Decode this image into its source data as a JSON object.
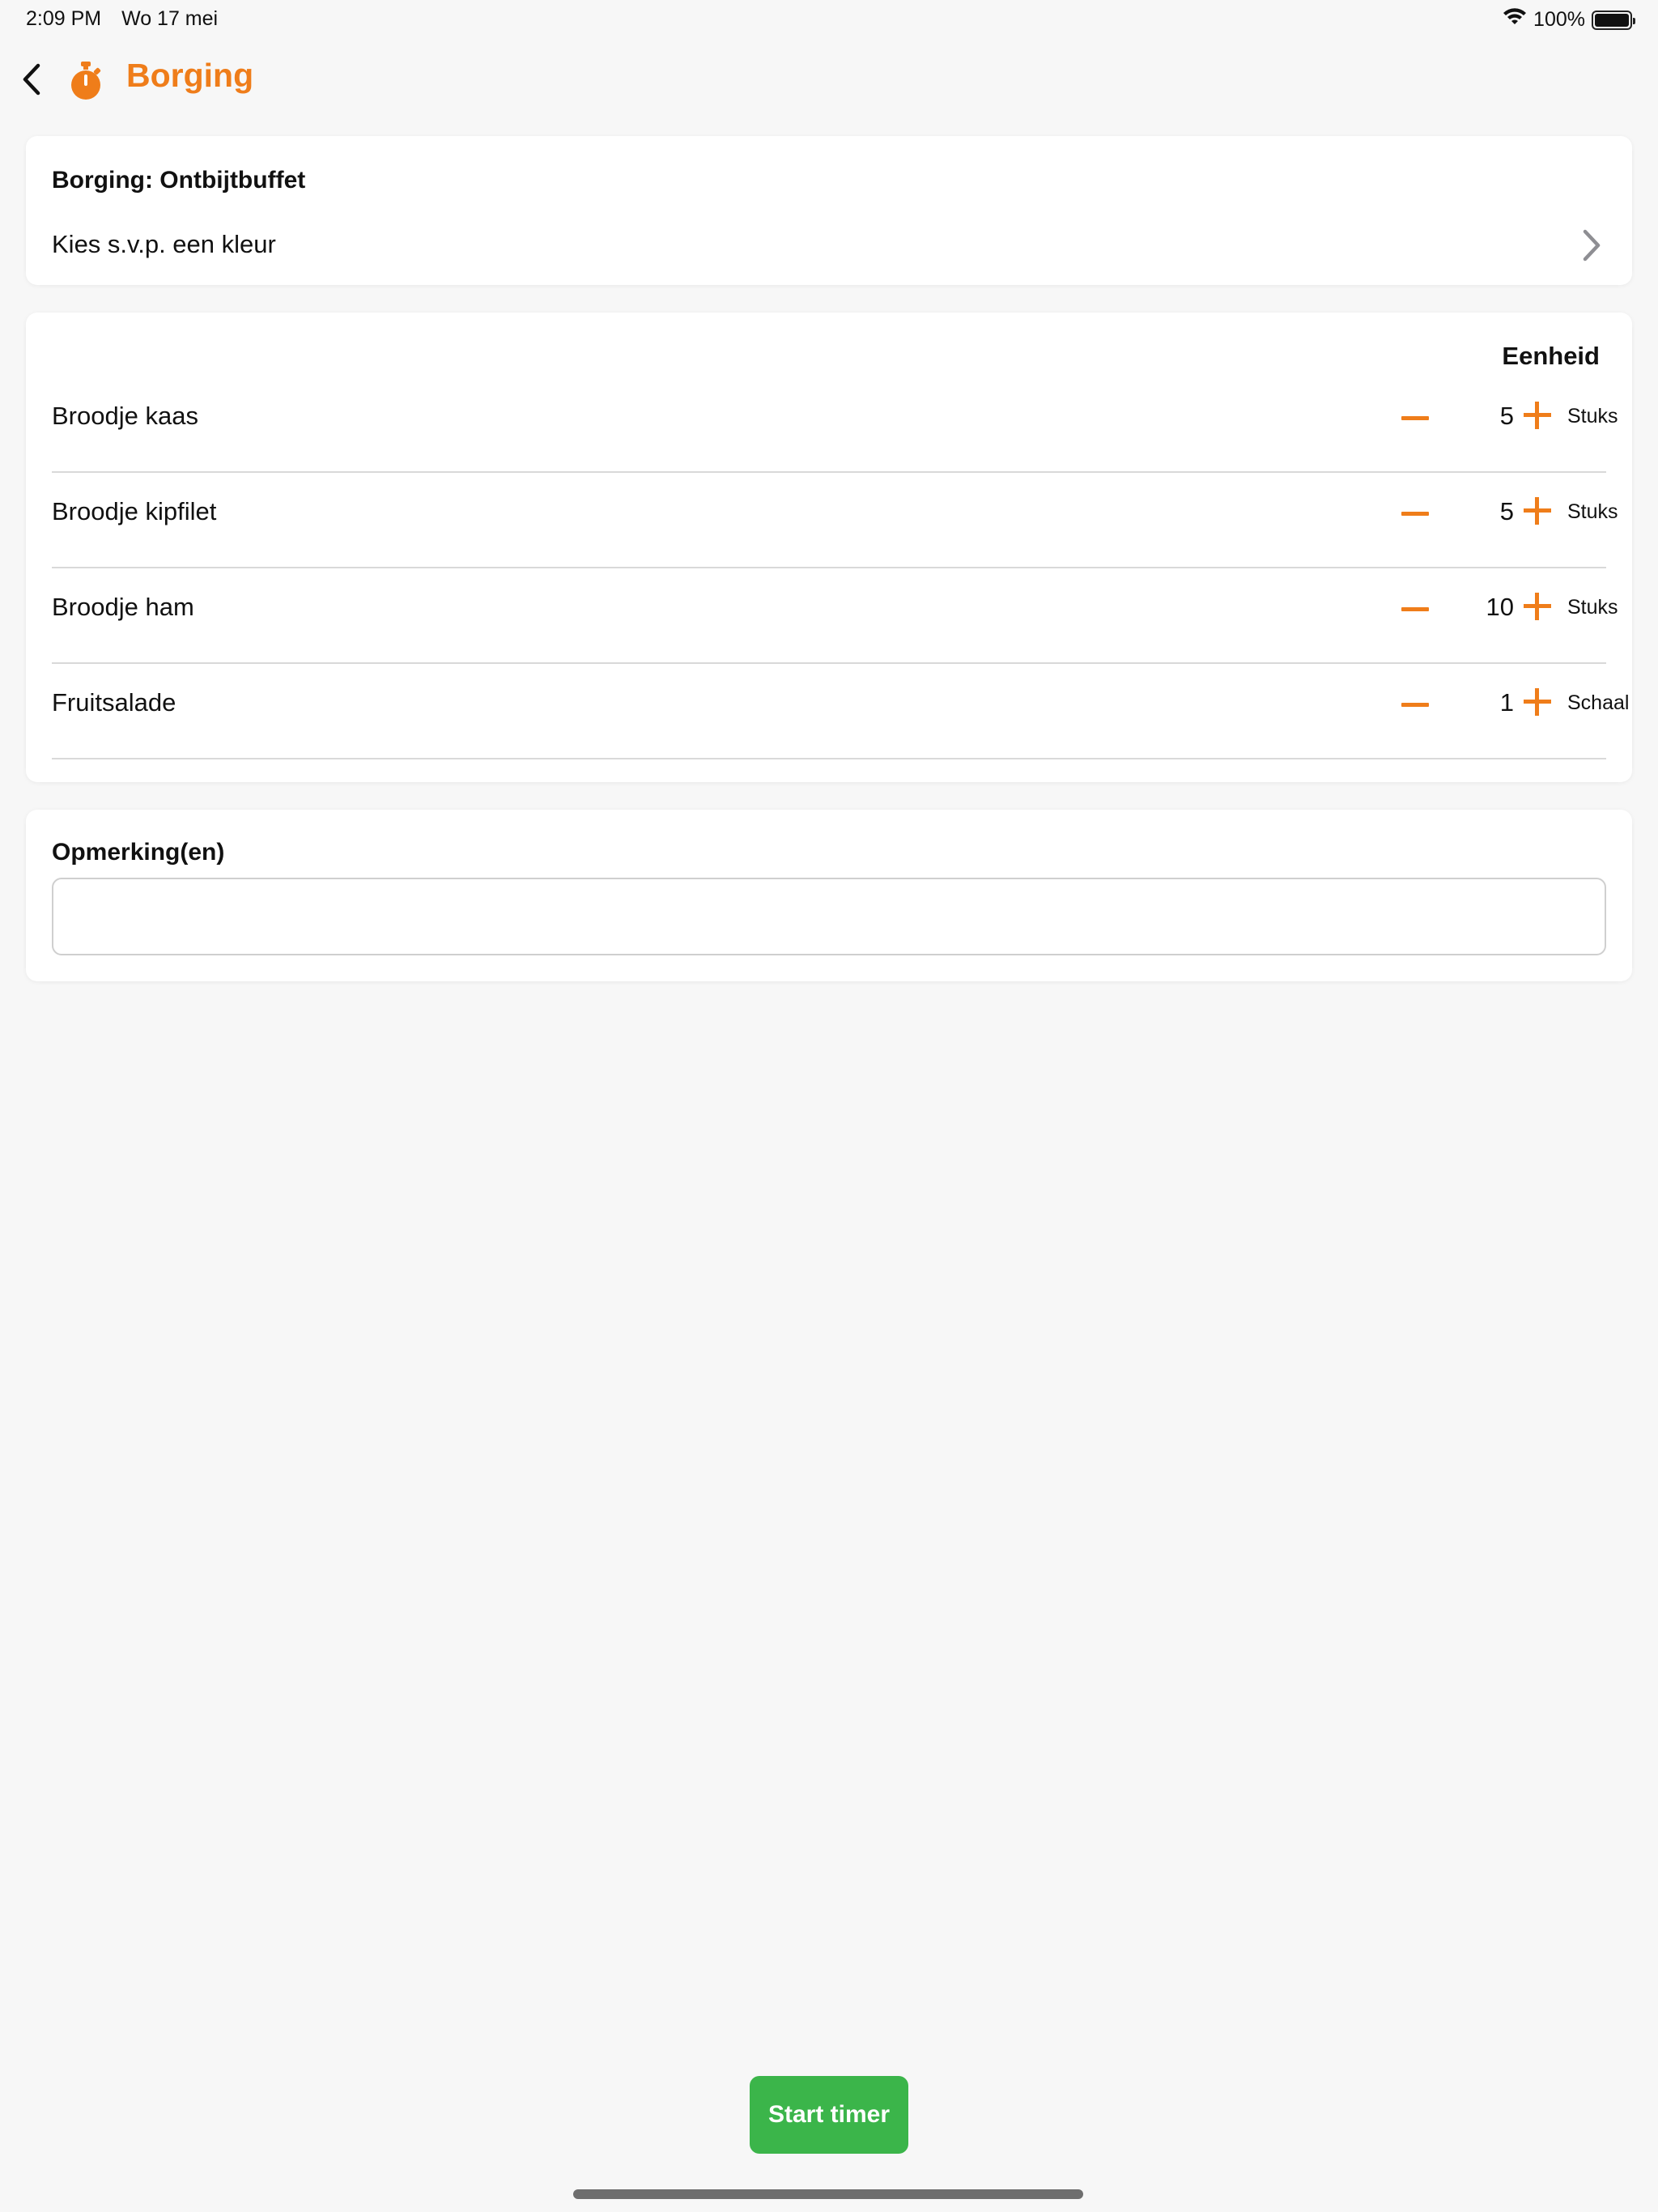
{
  "status_bar": {
    "time": "2:09 PM",
    "date": "Wo 17 mei",
    "battery": "100%",
    "icons": [
      "wifi-icon",
      "battery-icon"
    ]
  },
  "nav": {
    "title": "Borging",
    "icons": [
      "chevron-left-icon",
      "stopwatch-icon"
    ],
    "accent_color": "#ef7d1a"
  },
  "header_card": {
    "title": "Borging: Ontbijtbuffet",
    "color_prompt": "Kies s.v.p. een kleur",
    "icons": [
      "chevron-right-icon"
    ]
  },
  "items_card": {
    "unit_header": "Eenheid",
    "items": [
      {
        "name": "Broodje kaas",
        "qty": "5",
        "unit": "Stuks"
      },
      {
        "name": "Broodje kipfilet",
        "qty": "5",
        "unit": "Stuks"
      },
      {
        "name": "Broodje ham",
        "qty": "10",
        "unit": "Stuks"
      },
      {
        "name": "Fruitsalade",
        "qty": "1",
        "unit": "Schaal"
      }
    ]
  },
  "remarks_card": {
    "title": "Opmerking(en)",
    "value": "",
    "placeholder": ""
  },
  "footer": {
    "start_label": "Start timer",
    "start_color": "#3bb54a"
  }
}
